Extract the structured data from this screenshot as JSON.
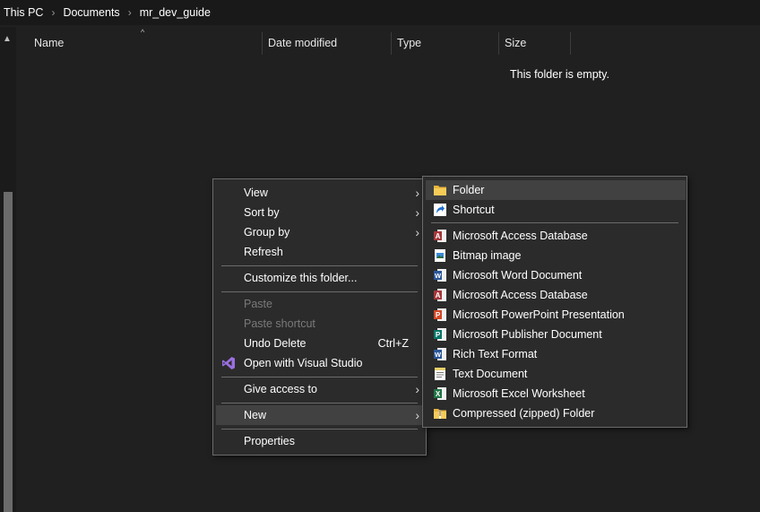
{
  "breadcrumb": {
    "items": [
      "This PC",
      "Documents",
      "mr_dev_guide"
    ],
    "separator": "›"
  },
  "columns": {
    "name": "Name",
    "date_modified": "Date modified",
    "type": "Type",
    "size": "Size"
  },
  "empty_message": "This folder is empty.",
  "context_menu": {
    "view": "View",
    "sort_by": "Sort by",
    "group_by": "Group by",
    "refresh": "Refresh",
    "customize": "Customize this folder...",
    "paste": "Paste",
    "paste_shortcut": "Paste shortcut",
    "undo_delete": "Undo Delete",
    "undo_shortcut": "Ctrl+Z",
    "open_with_vs": "Open with Visual Studio",
    "give_access": "Give access to",
    "new": "New",
    "properties": "Properties"
  },
  "new_submenu": {
    "items": [
      {
        "label": "Folder",
        "icon": "folder-icon"
      },
      {
        "label": "Shortcut",
        "icon": "shortcut-icon"
      },
      {
        "label": "Microsoft Access Database",
        "icon": "access-icon"
      },
      {
        "label": "Bitmap image",
        "icon": "bitmap-icon"
      },
      {
        "label": "Microsoft Word Document",
        "icon": "word-icon"
      },
      {
        "label": "Microsoft Access Database",
        "icon": "access-icon"
      },
      {
        "label": "Microsoft PowerPoint Presentation",
        "icon": "powerpoint-icon"
      },
      {
        "label": "Microsoft Publisher Document",
        "icon": "publisher-icon"
      },
      {
        "label": "Rich Text Format",
        "icon": "rtf-icon"
      },
      {
        "label": "Text Document",
        "icon": "text-document-icon"
      },
      {
        "label": "Microsoft Excel Worksheet",
        "icon": "excel-icon"
      },
      {
        "label": "Compressed (zipped) Folder",
        "icon": "zip-folder-icon"
      }
    ]
  },
  "colors": {
    "background": "#202020",
    "menu_background": "#2b2b2b",
    "menu_border": "#6b6b6b",
    "highlight": "#414141",
    "disabled_text": "#7a7a7a"
  }
}
